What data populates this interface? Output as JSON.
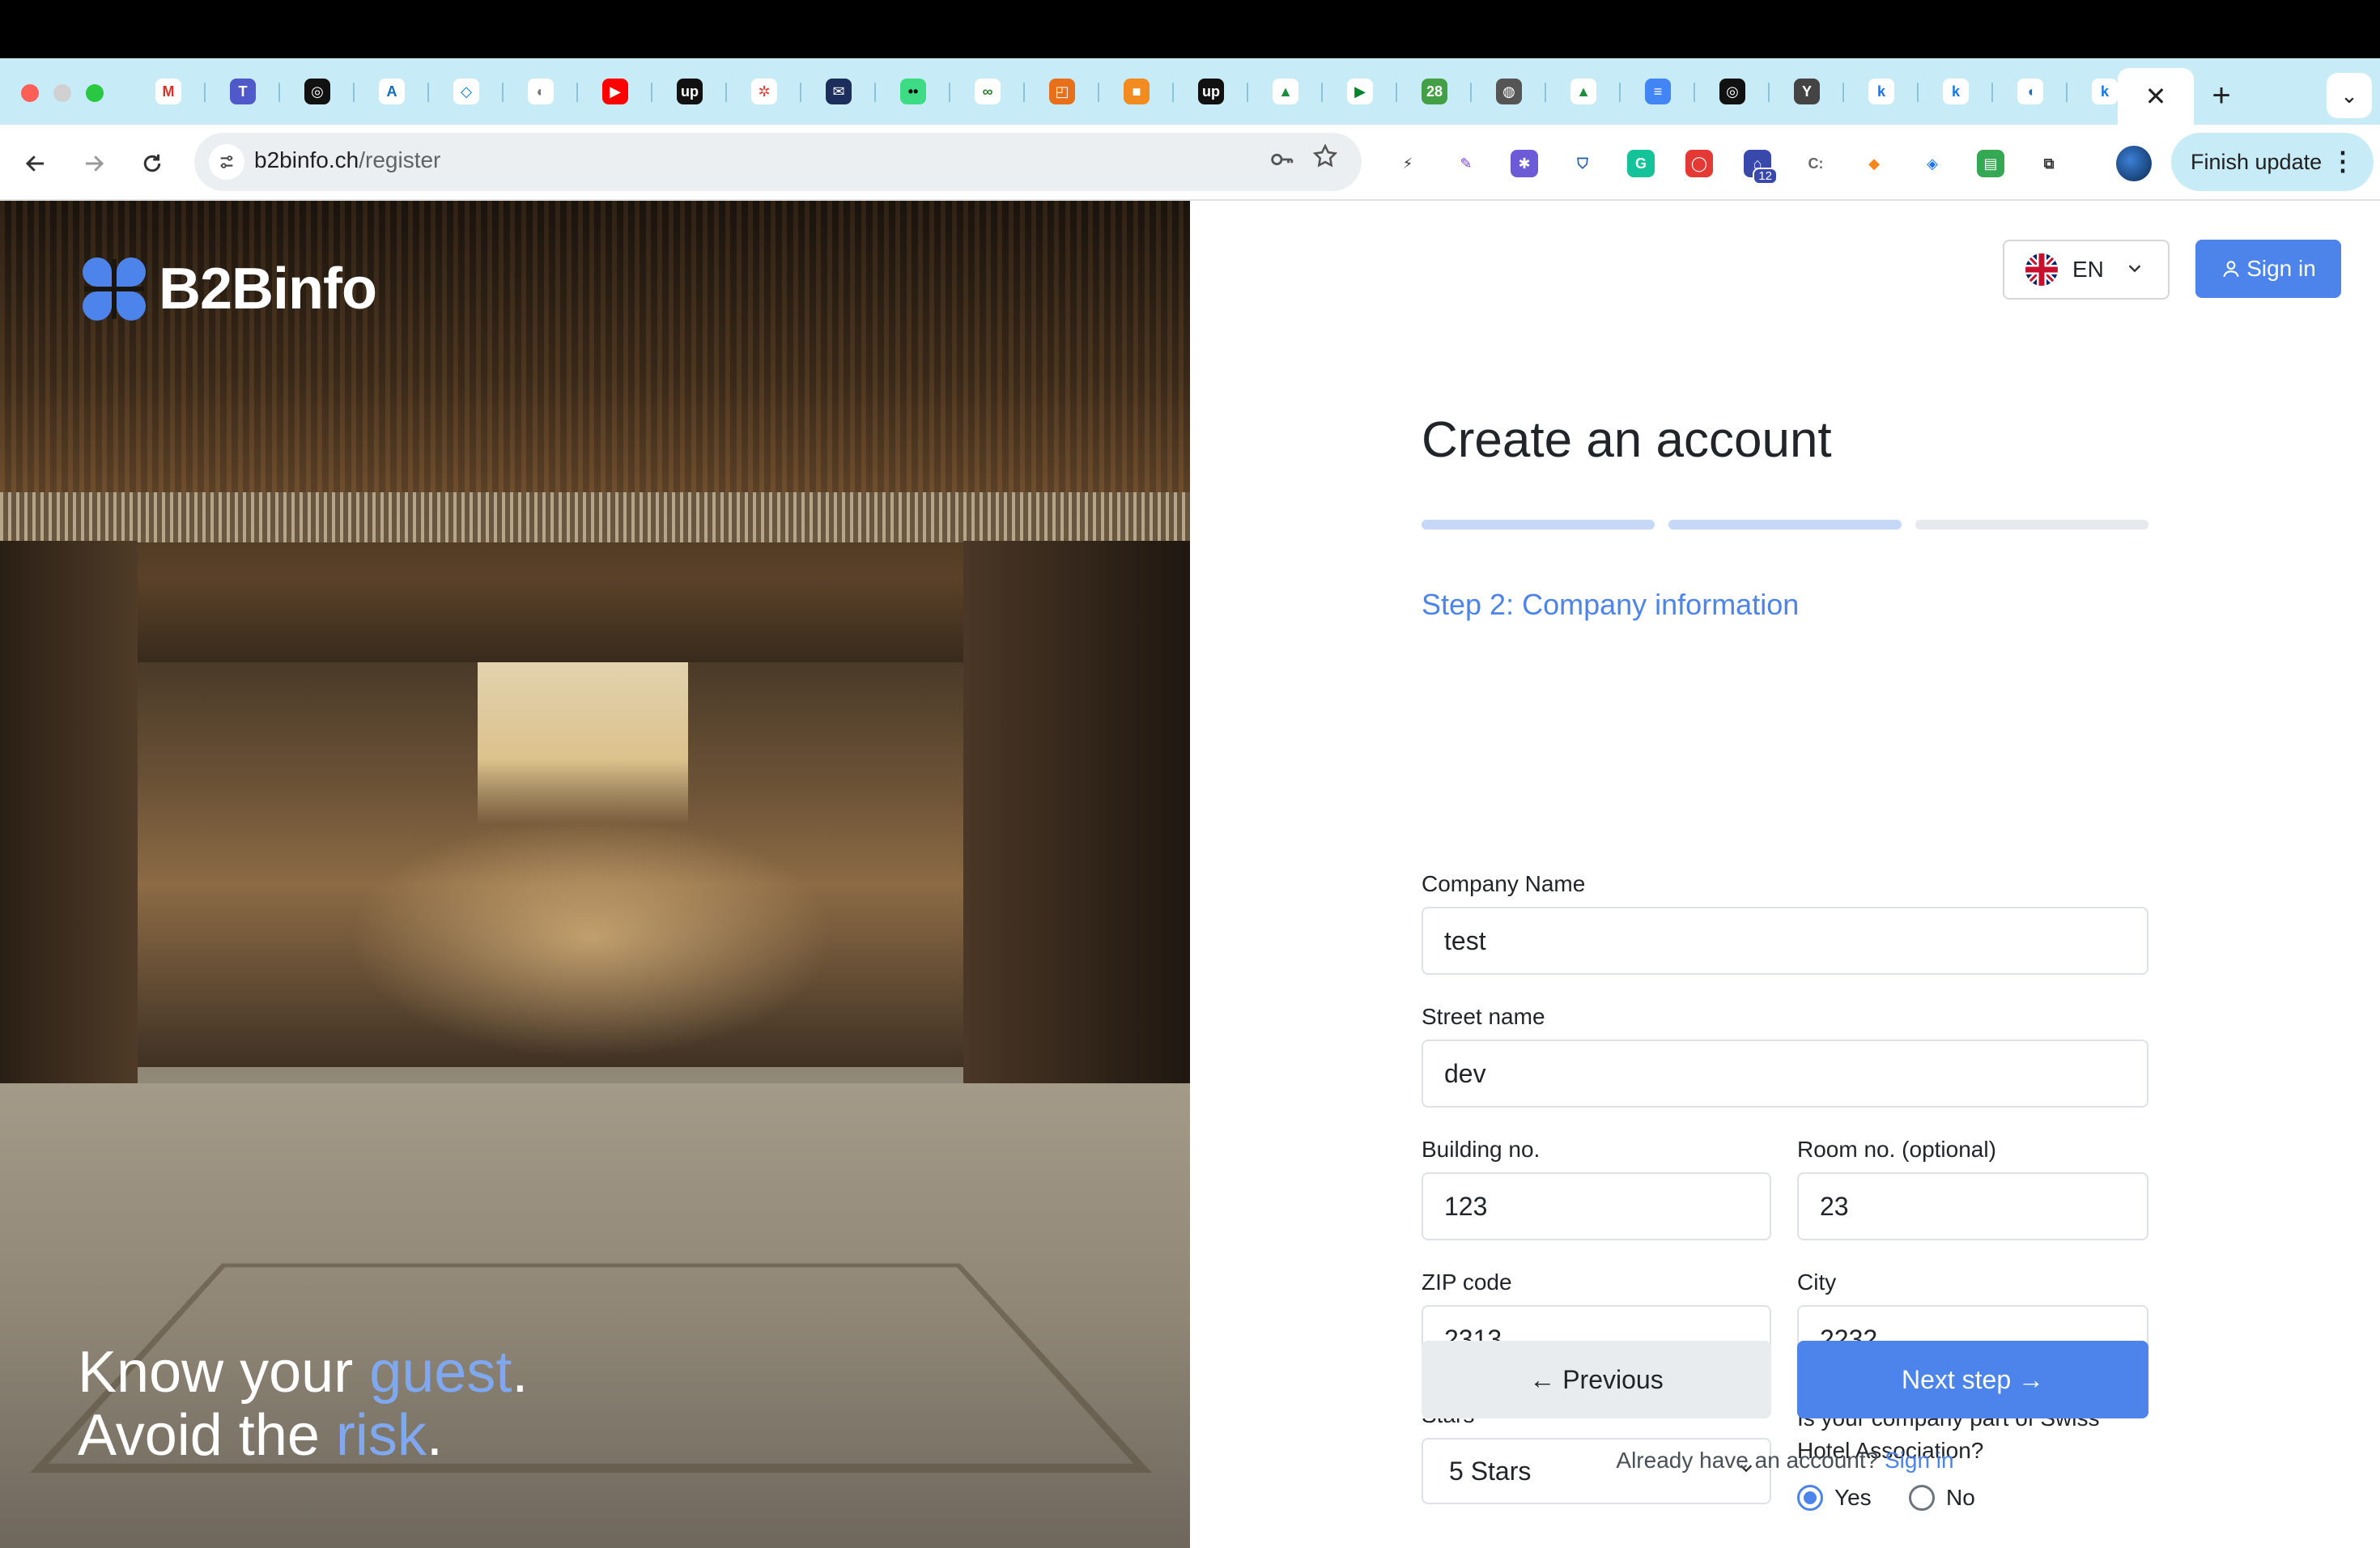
{
  "browser": {
    "tabs": [
      {
        "icon": "gmail-icon",
        "color": "#ffffff",
        "glyph": "M",
        "fg": "#d93025"
      },
      {
        "icon": "teams-icon",
        "color": "#5059c9",
        "glyph": "T",
        "fg": "#ffffff"
      },
      {
        "icon": "openai-icon",
        "color": "#111111",
        "glyph": "◎",
        "fg": "#ffffff"
      },
      {
        "icon": "azure-icon",
        "color": "#ffffff",
        "glyph": "A",
        "fg": "#0f6cbd"
      },
      {
        "icon": "azure-devops-icon",
        "color": "#ffffff",
        "glyph": "◇",
        "fg": "#0078d4"
      },
      {
        "icon": "blank-page-icon",
        "color": "#ffffff",
        "glyph": "◐",
        "fg": "#777777"
      },
      {
        "icon": "youtube-icon",
        "color": "#ff0000",
        "glyph": "▶",
        "fg": "#ffffff"
      },
      {
        "icon": "upwork-icon",
        "color": "#111111",
        "glyph": "up",
        "fg": "#ffffff"
      },
      {
        "icon": "helm-icon",
        "color": "#ffffff",
        "glyph": "✲",
        "fg": "#e0443e"
      },
      {
        "icon": "mail-envelope-icon",
        "color": "#1c2e5c",
        "glyph": "✉",
        "fg": "#ffffff"
      },
      {
        "icon": "green-dots-icon",
        "color": "#3ddc84",
        "glyph": "••",
        "fg": "#000000"
      },
      {
        "icon": "infinity-icon",
        "color": "#ffffff",
        "glyph": "∞",
        "fg": "#2e7d32"
      },
      {
        "icon": "orange-square-icon",
        "color": "#e8701a",
        "glyph": "◰",
        "fg": "#ffffff"
      },
      {
        "icon": "box-icon",
        "color": "#f28b20",
        "glyph": "■",
        "fg": "#ffffff"
      },
      {
        "icon": "upwork-icon",
        "color": "#111111",
        "glyph": "up",
        "fg": "#ffffff"
      },
      {
        "icon": "google-drive-icon",
        "color": "#ffffff",
        "glyph": "▲",
        "fg": "#1e8e3e"
      },
      {
        "icon": "google-meet-icon",
        "color": "#ffffff",
        "glyph": "▶",
        "fg": "#00832d"
      },
      {
        "icon": "calendar-28-icon",
        "color": "#43a047",
        "glyph": "28",
        "fg": "#ffffff"
      },
      {
        "icon": "globe-icon",
        "color": "#555555",
        "glyph": "◍",
        "fg": "#ffffff"
      },
      {
        "icon": "google-drive-icon",
        "color": "#ffffff",
        "glyph": "▲",
        "fg": "#1e8e3e"
      },
      {
        "icon": "google-docs-icon",
        "color": "#4285f4",
        "glyph": "≡",
        "fg": "#ffffff"
      },
      {
        "icon": "openai-icon",
        "color": "#111111",
        "glyph": "◎",
        "fg": "#ffffff"
      },
      {
        "icon": "y-combinator-icon",
        "color": "#444444",
        "glyph": "Y",
        "fg": "#ffffff"
      },
      {
        "icon": "k-logo-icon",
        "color": "#ffffff",
        "glyph": "k",
        "fg": "#1a73e8"
      },
      {
        "icon": "k-logo-icon",
        "color": "#ffffff",
        "glyph": "k",
        "fg": "#1a73e8"
      },
      {
        "icon": "leaf-icon",
        "color": "#ffffff",
        "glyph": "◖",
        "fg": "#2b6cb0"
      },
      {
        "icon": "k-logo-icon",
        "color": "#ffffff",
        "glyph": "k",
        "fg": "#1a73e8"
      }
    ],
    "active_tab_close": "✕",
    "new_tab": "+",
    "tab_search": "⌄",
    "url_host": "b2binfo.ch",
    "url_path": "/register",
    "extensions": [
      {
        "icon": "lightning-ext-icon",
        "color": "#ffffff",
        "glyph": "⚡",
        "fg": "#333333"
      },
      {
        "icon": "quill-ext-icon",
        "color": "#ffffff",
        "glyph": "✎",
        "fg": "#7b3fe4"
      },
      {
        "icon": "purple-ext-icon",
        "color": "#6b5bd6",
        "glyph": "✱",
        "fg": "#ffffff"
      },
      {
        "icon": "shield-ext-icon",
        "color": "#ffffff",
        "glyph": "⛉",
        "fg": "#1e5aa8"
      },
      {
        "icon": "grammarly-ext-icon",
        "color": "#15c39a",
        "glyph": "G",
        "fg": "#ffffff"
      },
      {
        "icon": "red-ext-icon",
        "color": "#e53935",
        "glyph": "◯",
        "fg": "#ffffff"
      },
      {
        "icon": "graduation-ext-icon",
        "color": "#3949ab",
        "glyph": "⌂",
        "fg": "#ffffff",
        "badge": "12"
      },
      {
        "icon": "c-bracket-ext-icon",
        "color": "#ffffff",
        "glyph": "C:",
        "fg": "#666666"
      },
      {
        "icon": "metamask-ext-icon",
        "color": "#ffffff",
        "glyph": "◆",
        "fg": "#f6851b"
      },
      {
        "icon": "tag-ext-icon",
        "color": "#ffffff",
        "glyph": "◈",
        "fg": "#1a73e8"
      },
      {
        "icon": "green-ext-icon",
        "color": "#34a853",
        "glyph": "▤",
        "fg": "#ffffff"
      },
      {
        "icon": "puzzle-ext-icon",
        "color": "#ffffff",
        "glyph": "⧉",
        "fg": "#333333"
      }
    ],
    "finish_update": "Finish update"
  },
  "hero": {
    "logo_text": "B2Binfo",
    "tagline_1a": "Know your ",
    "tagline_1b": "guest",
    "tagline_1c": ".",
    "tagline_2a": "Avoid the ",
    "tagline_2b": "risk",
    "tagline_2c": "."
  },
  "header": {
    "language": "EN",
    "sign_in": "Sign in"
  },
  "form": {
    "title": "Create an account",
    "progress_steps": [
      {
        "done": true
      },
      {
        "done": true
      },
      {
        "done": false
      }
    ],
    "step_title": "Step 2: Company information",
    "company_name": {
      "label": "Company Name",
      "value": "test"
    },
    "street_name": {
      "label": "Street name",
      "value": "dev"
    },
    "building_no": {
      "label": "Building no.",
      "value": "123"
    },
    "room_no": {
      "label": "Room no. (optional)",
      "value": "23"
    },
    "zip_code": {
      "label": "ZIP code",
      "value": "2313"
    },
    "city": {
      "label": "City",
      "value": "2232"
    },
    "stars": {
      "label": "Stars",
      "value": "5 Stars"
    },
    "swiss_assoc": {
      "label_line1": "Is your company part of Swiss",
      "label_line2": "Hotel Association?",
      "yes": "Yes",
      "no": "No",
      "selected": "Yes"
    },
    "previous": "← Previous",
    "next": "Next step →",
    "footer_prefix": "Already have an account? ",
    "footer_link": "Sign in"
  },
  "colors": {
    "accent": "#4c84eb",
    "tabstrip": "#c8ecf7"
  }
}
